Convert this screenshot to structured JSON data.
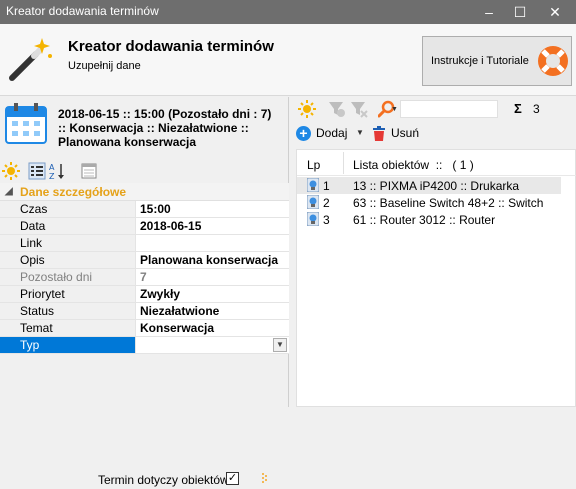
{
  "window": {
    "title": "Kreator dodawania terminów",
    "minimize": "–",
    "maximize": "☐",
    "close": "✕"
  },
  "header": {
    "title": "Kreator dodawania terminów",
    "subtitle": "Uzupełnij dane",
    "tutorial_button": "Instrukcje i Tutoriale"
  },
  "summary": {
    "line1": "2018-06-15 :: 15:00 (Pozostało dni : 7)",
    "line2": ":: Konserwacja :: Niezałatwione ::",
    "line3": "Planowana konserwacja"
  },
  "properties": {
    "category": "Dane szczegółowe",
    "rows": [
      {
        "key": "Czas",
        "value": "15:00"
      },
      {
        "key": "Data",
        "value": "2018-06-15"
      },
      {
        "key": "Link",
        "value": ""
      },
      {
        "key": "Opis",
        "value": "Planowana konserwacja"
      },
      {
        "key": "Pozostało dni",
        "value": "7"
      },
      {
        "key": "Priorytet",
        "value": "Zwykły"
      },
      {
        "key": "Status",
        "value": "Niezałatwione"
      },
      {
        "key": "Temat",
        "value": "Konserwacja"
      },
      {
        "key": "Typ",
        "value": ""
      }
    ]
  },
  "checkbox": {
    "label": "Termin dotyczy obiektów",
    "checked": true,
    "mark": "✓"
  },
  "right_toolbar": {
    "sigma": "Σ",
    "count": "3",
    "search_value": ""
  },
  "actions": {
    "add_label": "Dodaj",
    "delete_label": "Usuń"
  },
  "list": {
    "col_lp": "Lp",
    "col_objects": "Lista obiektów  ::   ( 1 )",
    "items": [
      {
        "num": "1",
        "text": "13 :: PIXMA iP4200 :: Drukarka"
      },
      {
        "num": "2",
        "text": "63 :: Baseline Switch 48+2 :: Switch"
      },
      {
        "num": "3",
        "text": "61 :: Router 3012 :: Router"
      }
    ]
  },
  "colors": {
    "titlebar": "#6e6e6e",
    "category": "#e5a21a",
    "selection": "#0078d7",
    "accent_blue": "#1e88e5"
  }
}
